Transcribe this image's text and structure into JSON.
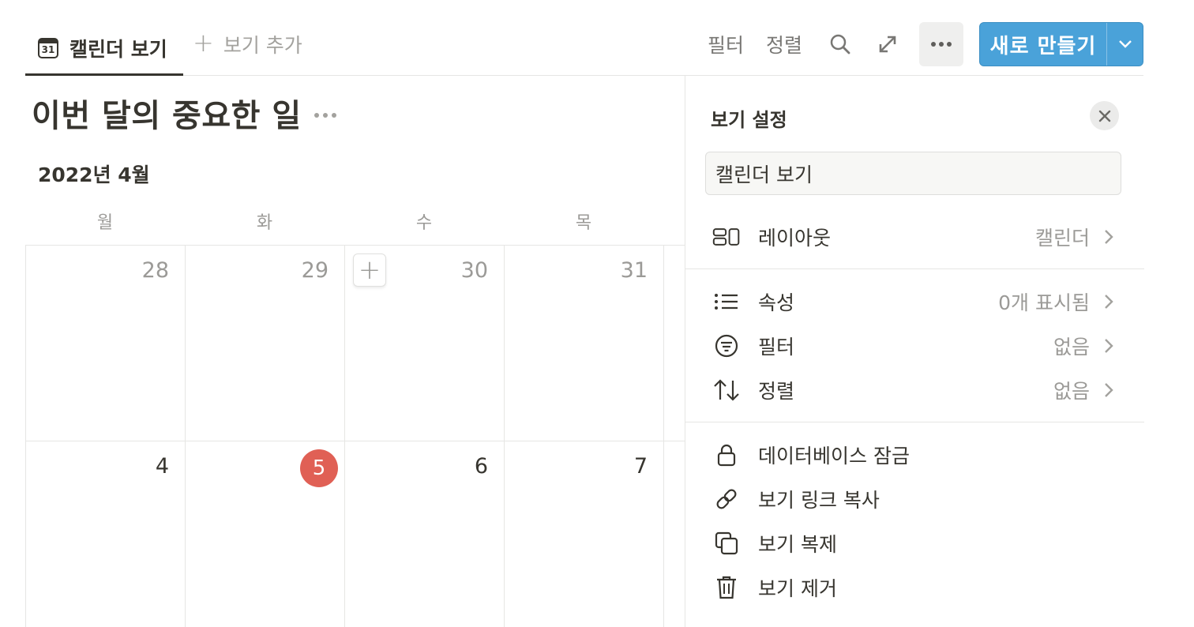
{
  "toolbar": {
    "view_tab_label": "캘린더 보기",
    "calendar_icon_text": "31",
    "add_view_label": "보기 추가",
    "filter_label": "필터",
    "sort_label": "정렬",
    "new_button_label": "새로 만들기",
    "icons": [
      "search-icon",
      "expand-icon",
      "more-icon",
      "chevron-down-icon"
    ]
  },
  "page": {
    "title": "이번 달의 중요한 일",
    "month": "2022년 4월"
  },
  "calendar": {
    "weekdays": [
      "월",
      "화",
      "수",
      "목"
    ],
    "week1": [
      "28",
      "29",
      "30",
      "31"
    ],
    "week2": [
      "4",
      "5",
      "6",
      "7"
    ],
    "today": "5",
    "today_color": "#e06055"
  },
  "panel": {
    "title": "보기 설정",
    "view_name": "캘린더 보기",
    "layout": {
      "label": "레이아웃",
      "value": "캘린더"
    },
    "properties": {
      "label": "속성",
      "value": "0개 표시됨"
    },
    "filter": {
      "label": "필터",
      "value": "없음"
    },
    "sort": {
      "label": "정렬",
      "value": "없음"
    },
    "lock": {
      "label": "데이터베이스 잠금"
    },
    "copy_link": {
      "label": "보기 링크 복사"
    },
    "duplicate": {
      "label": "보기 복제"
    },
    "remove": {
      "label": "보기 제거"
    }
  },
  "colors": {
    "accent": "#4aa2d9",
    "text": "#37352f",
    "muted": "#9b9a97"
  }
}
